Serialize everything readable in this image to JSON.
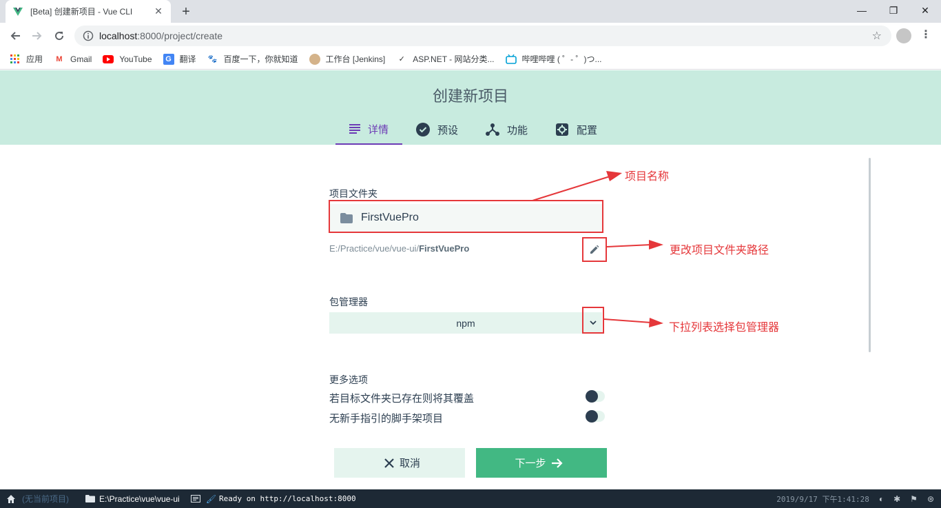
{
  "browser": {
    "tab_title": "[Beta] 创建新项目 - Vue CLI",
    "url_host": "localhost",
    "url_path": ":8000/project/create",
    "bookmarks": [
      "应用",
      "Gmail",
      "YouTube",
      "翻译",
      "百度一下，你就知道",
      "工作台 [Jenkins]",
      "ASP.NET - 网站分类...",
      "哔哩哔哩 ( ゜- ゜)つ..."
    ]
  },
  "app": {
    "page_title": "创建新项目",
    "steps": [
      "详情",
      "预设",
      "功能",
      "配置"
    ],
    "active_step": 0
  },
  "form": {
    "folder_label": "项目文件夹",
    "folder_value": "FirstVuePro",
    "path_prefix": "E:/Practice/vue/vue-ui/",
    "path_name": "FirstVuePro",
    "pm_label": "包管理器",
    "pm_value": "npm",
    "more_label": "更多选项",
    "options": [
      {
        "label": "若目标文件夹已存在则将其覆盖",
        "on": false
      },
      {
        "label": "无新手指引的脚手架项目",
        "on": false
      }
    ],
    "cancel_label": "取消",
    "next_label": "下一步"
  },
  "annotations": {
    "name": "项目名称",
    "path": "更改项目文件夹路径",
    "pm": "下拉列表选择包管理器"
  },
  "statusbar": {
    "project": "(无当前项目)",
    "folder": "E:\\Practice\\vue\\vue-ui",
    "log": "Ready on http://localhost:8000",
    "datetime": "2019/9/17 下午1:41:28"
  },
  "colors": {
    "accent": "#42b883",
    "header_bg": "#c8ebdf",
    "active_step": "#6c3bb5",
    "annotation": "#e5373a"
  }
}
